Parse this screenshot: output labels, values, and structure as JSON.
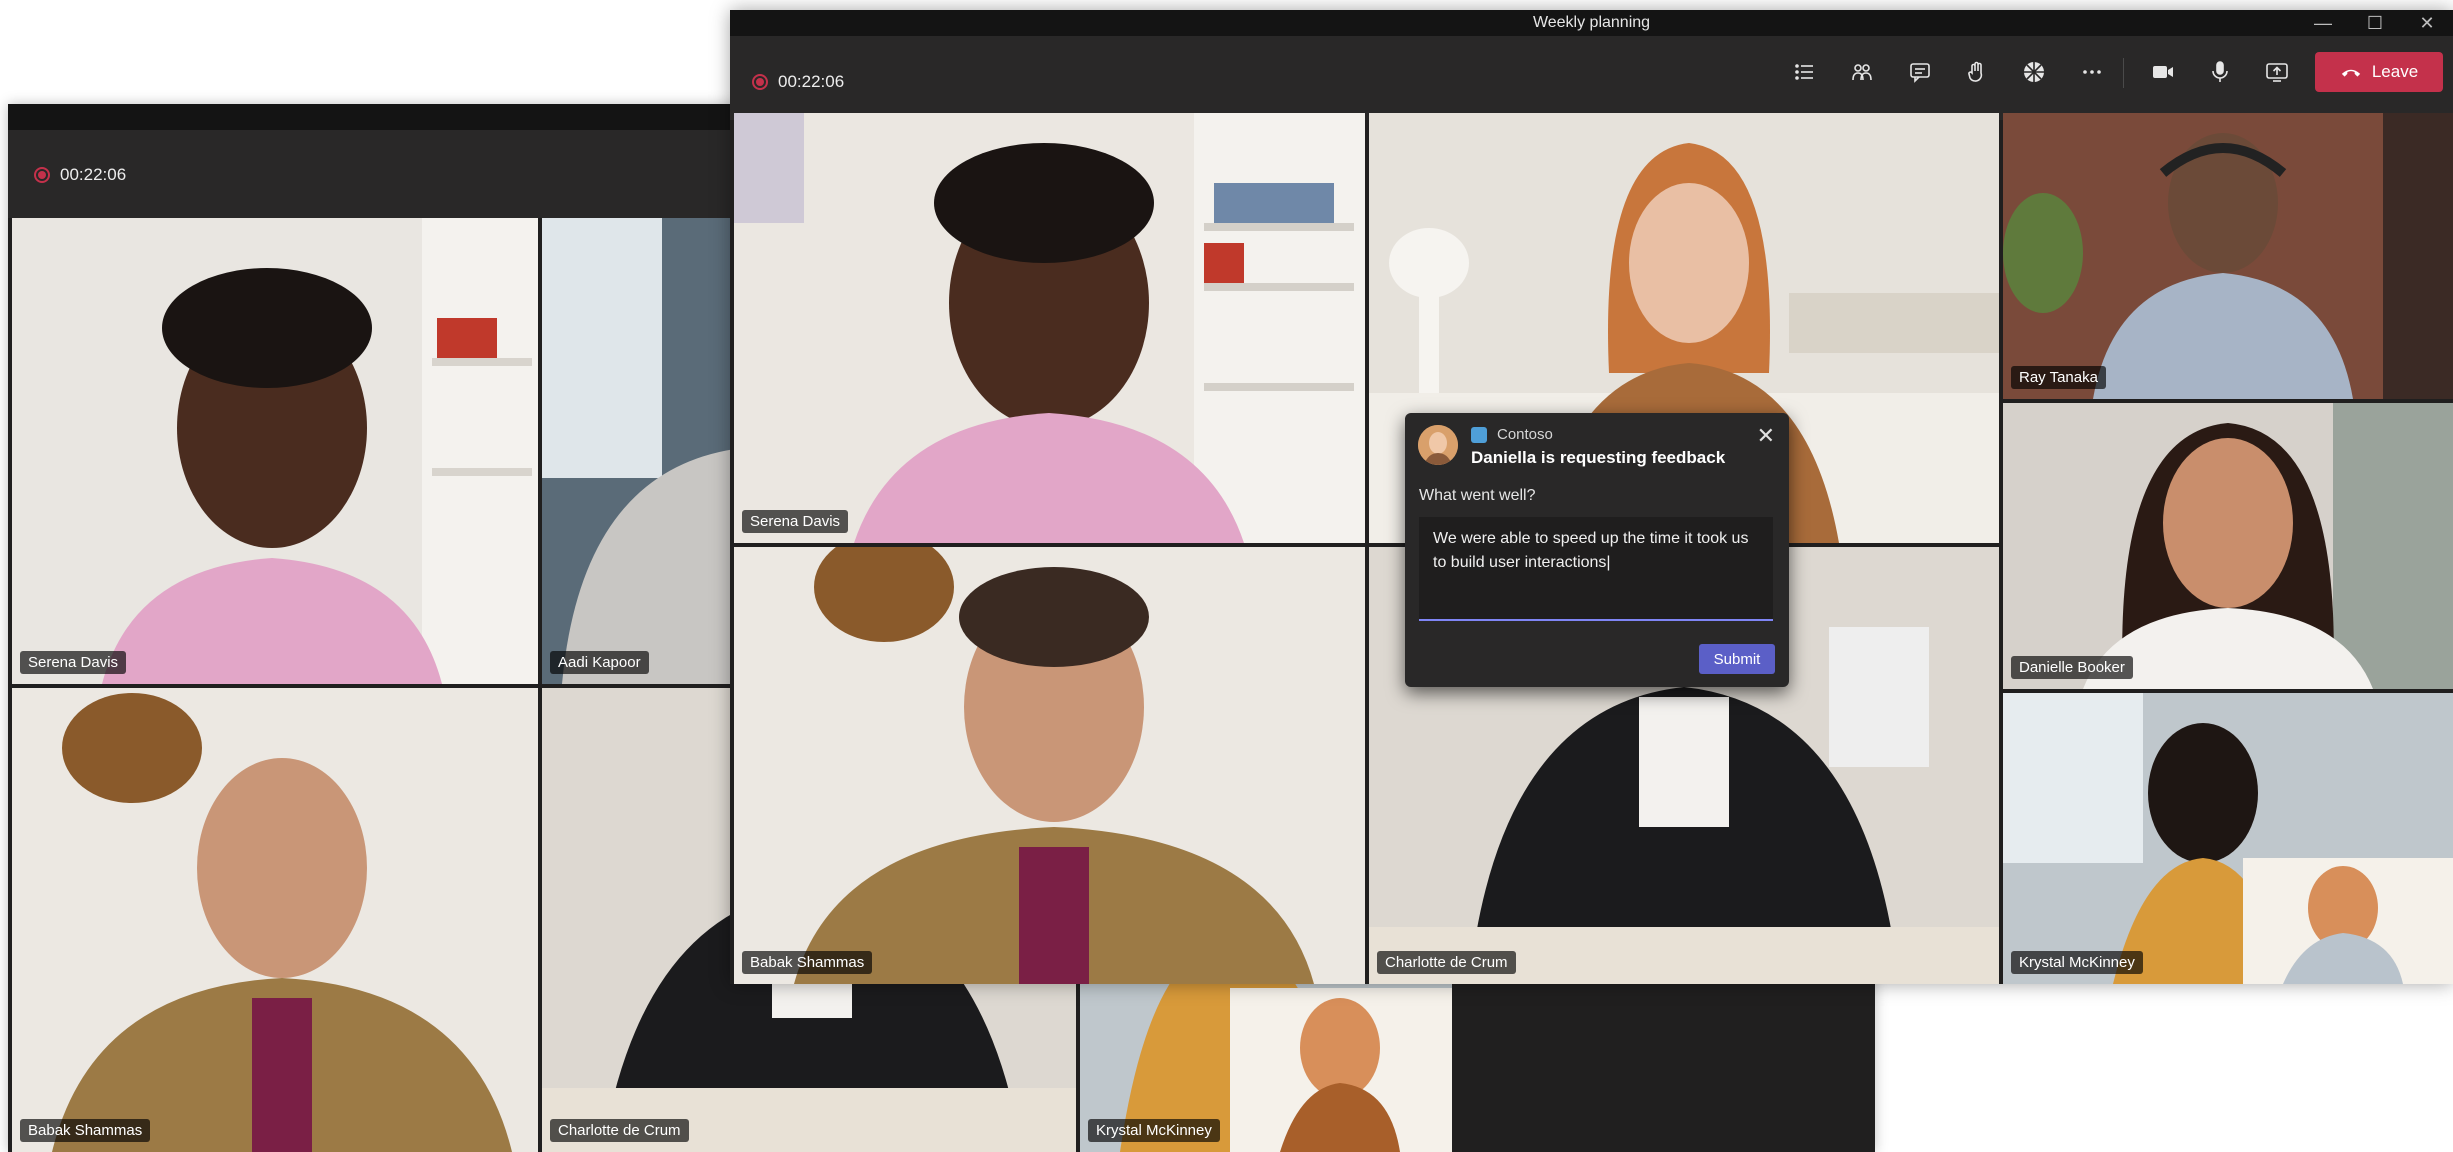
{
  "front_window": {
    "title": "Weekly planning",
    "timer": "00:22:06",
    "leave_label": "Leave",
    "tiles": [
      {
        "name": "Serena Davis"
      },
      {
        "name": ""
      },
      {
        "name": "Ray Tanaka"
      },
      {
        "name": "Danielle Booker"
      },
      {
        "name": "Babak Shammas"
      },
      {
        "name": "Charlotte de Crum"
      },
      {
        "name": "Krystal McKinney"
      }
    ]
  },
  "back_window": {
    "timer": "00:22:06",
    "tiles": [
      {
        "name": "Serena Davis"
      },
      {
        "name": "Aadi Kapoor"
      },
      {
        "name": "Babak Shammas"
      },
      {
        "name": "Charlotte de Crum"
      },
      {
        "name": "Krystal McKinney"
      }
    ]
  },
  "feedback_card": {
    "app_name": "Contoso",
    "heading": "Daniella is requesting feedback",
    "question": "What went well?",
    "answer": "We were able to speed up the time it took us to build user interactions|",
    "submit_label": "Submit",
    "close_glyph": "✕"
  },
  "window_controls": {
    "minimize": "—",
    "maximize": "☐",
    "close": "✕"
  },
  "colors": {
    "accent": "#5b5fc7",
    "leave": "#c4314b",
    "recording": "#c4314b",
    "toolbar": "#292828"
  }
}
